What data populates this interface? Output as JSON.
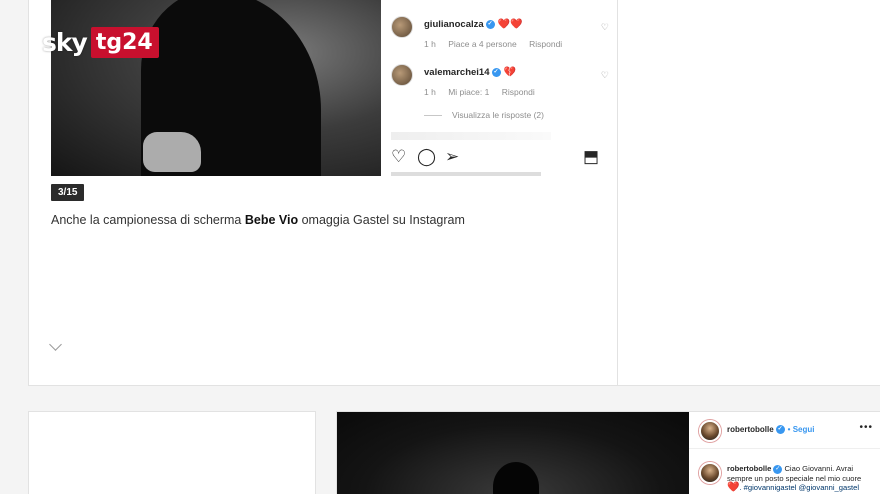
{
  "logo": {
    "sky": "sky",
    "tg": "tg24"
  },
  "gallery": {
    "counter": "3/15",
    "caption_before": "Anche la campionessa di scherma ",
    "caption_bold": "Bebe Vio",
    "caption_after": " omaggia Gastel su Instagram"
  },
  "instagram_main": {
    "comments": [
      {
        "user": "giulianocalza",
        "emoji": "❤️❤️",
        "time": "1 h",
        "likes": "Piace a 4 persone",
        "reply": "Rispondi"
      },
      {
        "user": "valemarchei14",
        "emoji": "💔",
        "time": "1 h",
        "likes": "Mi piace: 1",
        "reply": "Rispondi"
      }
    ],
    "view_replies": "Visualizza le risposte (2)",
    "actions": {
      "like": "♡",
      "comment": "◯",
      "share": "➢",
      "save": "⬒"
    },
    "like_icon": "♡"
  },
  "instagram_second": {
    "user": "robertobolle",
    "follow": "• Segui",
    "more": "•••",
    "comment_user": "robertobolle",
    "comment_text": "Ciao Giovanni. Avrai sempre un posto speciale nel mio cuore",
    "comment_emoji": "❤️",
    "comment_tags": ". #giovannigastel @giovanni_gastel"
  }
}
